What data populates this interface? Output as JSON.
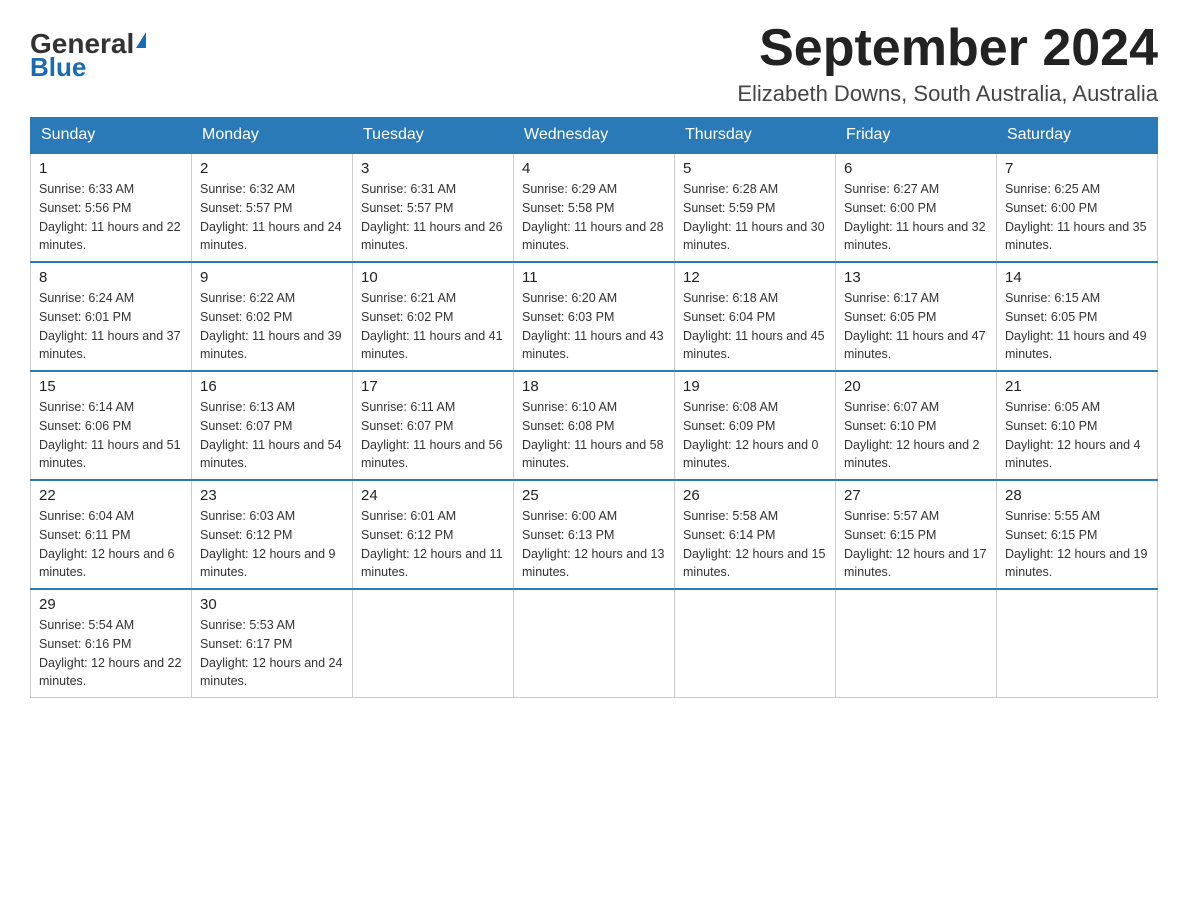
{
  "header": {
    "logo_general": "General",
    "logo_blue": "Blue",
    "title": "September 2024",
    "subtitle": "Elizabeth Downs, South Australia, Australia"
  },
  "days_of_week": [
    "Sunday",
    "Monday",
    "Tuesday",
    "Wednesday",
    "Thursday",
    "Friday",
    "Saturday"
  ],
  "weeks": [
    [
      {
        "day": "1",
        "sunrise": "6:33 AM",
        "sunset": "5:56 PM",
        "daylight": "11 hours and 22 minutes."
      },
      {
        "day": "2",
        "sunrise": "6:32 AM",
        "sunset": "5:57 PM",
        "daylight": "11 hours and 24 minutes."
      },
      {
        "day": "3",
        "sunrise": "6:31 AM",
        "sunset": "5:57 PM",
        "daylight": "11 hours and 26 minutes."
      },
      {
        "day": "4",
        "sunrise": "6:29 AM",
        "sunset": "5:58 PM",
        "daylight": "11 hours and 28 minutes."
      },
      {
        "day": "5",
        "sunrise": "6:28 AM",
        "sunset": "5:59 PM",
        "daylight": "11 hours and 30 minutes."
      },
      {
        "day": "6",
        "sunrise": "6:27 AM",
        "sunset": "6:00 PM",
        "daylight": "11 hours and 32 minutes."
      },
      {
        "day": "7",
        "sunrise": "6:25 AM",
        "sunset": "6:00 PM",
        "daylight": "11 hours and 35 minutes."
      }
    ],
    [
      {
        "day": "8",
        "sunrise": "6:24 AM",
        "sunset": "6:01 PM",
        "daylight": "11 hours and 37 minutes."
      },
      {
        "day": "9",
        "sunrise": "6:22 AM",
        "sunset": "6:02 PM",
        "daylight": "11 hours and 39 minutes."
      },
      {
        "day": "10",
        "sunrise": "6:21 AM",
        "sunset": "6:02 PM",
        "daylight": "11 hours and 41 minutes."
      },
      {
        "day": "11",
        "sunrise": "6:20 AM",
        "sunset": "6:03 PM",
        "daylight": "11 hours and 43 minutes."
      },
      {
        "day": "12",
        "sunrise": "6:18 AM",
        "sunset": "6:04 PM",
        "daylight": "11 hours and 45 minutes."
      },
      {
        "day": "13",
        "sunrise": "6:17 AM",
        "sunset": "6:05 PM",
        "daylight": "11 hours and 47 minutes."
      },
      {
        "day": "14",
        "sunrise": "6:15 AM",
        "sunset": "6:05 PM",
        "daylight": "11 hours and 49 minutes."
      }
    ],
    [
      {
        "day": "15",
        "sunrise": "6:14 AM",
        "sunset": "6:06 PM",
        "daylight": "11 hours and 51 minutes."
      },
      {
        "day": "16",
        "sunrise": "6:13 AM",
        "sunset": "6:07 PM",
        "daylight": "11 hours and 54 minutes."
      },
      {
        "day": "17",
        "sunrise": "6:11 AM",
        "sunset": "6:07 PM",
        "daylight": "11 hours and 56 minutes."
      },
      {
        "day": "18",
        "sunrise": "6:10 AM",
        "sunset": "6:08 PM",
        "daylight": "11 hours and 58 minutes."
      },
      {
        "day": "19",
        "sunrise": "6:08 AM",
        "sunset": "6:09 PM",
        "daylight": "12 hours and 0 minutes."
      },
      {
        "day": "20",
        "sunrise": "6:07 AM",
        "sunset": "6:10 PM",
        "daylight": "12 hours and 2 minutes."
      },
      {
        "day": "21",
        "sunrise": "6:05 AM",
        "sunset": "6:10 PM",
        "daylight": "12 hours and 4 minutes."
      }
    ],
    [
      {
        "day": "22",
        "sunrise": "6:04 AM",
        "sunset": "6:11 PM",
        "daylight": "12 hours and 6 minutes."
      },
      {
        "day": "23",
        "sunrise": "6:03 AM",
        "sunset": "6:12 PM",
        "daylight": "12 hours and 9 minutes."
      },
      {
        "day": "24",
        "sunrise": "6:01 AM",
        "sunset": "6:12 PM",
        "daylight": "12 hours and 11 minutes."
      },
      {
        "day": "25",
        "sunrise": "6:00 AM",
        "sunset": "6:13 PM",
        "daylight": "12 hours and 13 minutes."
      },
      {
        "day": "26",
        "sunrise": "5:58 AM",
        "sunset": "6:14 PM",
        "daylight": "12 hours and 15 minutes."
      },
      {
        "day": "27",
        "sunrise": "5:57 AM",
        "sunset": "6:15 PM",
        "daylight": "12 hours and 17 minutes."
      },
      {
        "day": "28",
        "sunrise": "5:55 AM",
        "sunset": "6:15 PM",
        "daylight": "12 hours and 19 minutes."
      }
    ],
    [
      {
        "day": "29",
        "sunrise": "5:54 AM",
        "sunset": "6:16 PM",
        "daylight": "12 hours and 22 minutes."
      },
      {
        "day": "30",
        "sunrise": "5:53 AM",
        "sunset": "6:17 PM",
        "daylight": "12 hours and 24 minutes."
      },
      null,
      null,
      null,
      null,
      null
    ]
  ]
}
